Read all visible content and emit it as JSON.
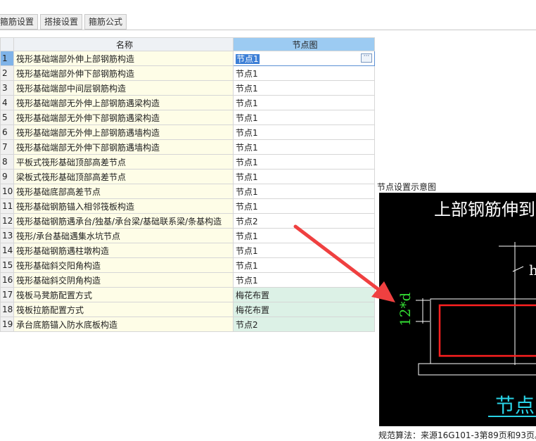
{
  "tabs": [
    "箍筋设置",
    "搭接设置",
    "箍筋公式"
  ],
  "grid": {
    "headers": [
      "名称",
      "节点图"
    ],
    "rows": [
      {
        "num": "1",
        "name": "筏形基础端部外伸上部钢筋构造",
        "value": "节点1"
      },
      {
        "num": "2",
        "name": "筏形基础端部外伸下部钢筋构造",
        "value": "节点1"
      },
      {
        "num": "3",
        "name": "筏形基础端部中间层钢筋构造",
        "value": "节点1"
      },
      {
        "num": "4",
        "name": "筏形基础端部无外伸上部钢筋遇梁构造",
        "value": "节点1"
      },
      {
        "num": "5",
        "name": "筏形基础端部无外伸下部钢筋遇梁构造",
        "value": "节点1"
      },
      {
        "num": "6",
        "name": "筏形基础端部无外伸上部钢筋遇墙构造",
        "value": "节点1"
      },
      {
        "num": "7",
        "name": "筏形基础端部无外伸下部钢筋遇墙构造",
        "value": "节点1"
      },
      {
        "num": "8",
        "name": "平板式筏形基础顶部高差节点",
        "value": "节点1"
      },
      {
        "num": "9",
        "name": "梁板式筏形基础顶部高差节点",
        "value": "节点1"
      },
      {
        "num": "10",
        "name": "筏形基础底部高差节点",
        "value": "节点1"
      },
      {
        "num": "11",
        "name": "筏形基础钢筋锚入相邻筏板构造",
        "value": "节点1"
      },
      {
        "num": "12",
        "name": "筏形基础钢筋遇承台/独基/承台梁/基础联系梁/条基构造",
        "value": "节点2"
      },
      {
        "num": "13",
        "name": "筏形/承台基础遇集水坑节点",
        "value": "节点1"
      },
      {
        "num": "14",
        "name": "筏形基础钢筋遇柱墩构造",
        "value": "节点1"
      },
      {
        "num": "15",
        "name": "筏形基础斜交阳角构造",
        "value": "节点1"
      },
      {
        "num": "16",
        "name": "筏形基础斜交阴角构造",
        "value": "节点1"
      },
      {
        "num": "17",
        "name": "筏板马凳筋配置方式",
        "value": "梅花布置"
      },
      {
        "num": "18",
        "name": "筏板拉筋配置方式",
        "value": "梅花布置"
      },
      {
        "num": "19",
        "name": "承台底筋锚入防水底板构造",
        "value": "节点2"
      }
    ]
  },
  "panel": {
    "title": "节点设置示意图",
    "diagram_title": "上部钢筋伸到",
    "dim_label": "12*d",
    "h_label": "h",
    "caption": "节点",
    "footer": "规范算法：来源16G101-3第89页和93页。"
  },
  "colors": {
    "rebar": "#ff2020",
    "dimension": "#33dd33",
    "caption": "#29d3e6",
    "arrow": "#ef4040"
  }
}
